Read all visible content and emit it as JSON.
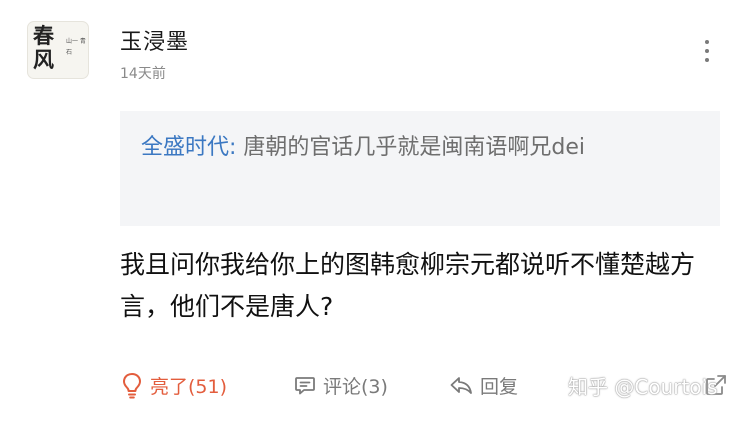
{
  "post": {
    "avatar_text": "春风",
    "avatar_small": "山一 青石",
    "author": "玉浸墨",
    "time": "14天前",
    "quote": {
      "name": "全盛时代:",
      "text": " 唐朝的官话几乎就是闽南语啊兄dei"
    },
    "content": "我且问你我给你上的图韩愈柳宗元都说听不懂楚越方言，他们不是唐人?",
    "actions": {
      "like_label": "亮了(51)",
      "comment_label": "评论(3)",
      "reply_label": "回复"
    },
    "watermark": "知乎 @Courtois"
  },
  "colors": {
    "accent_like": "#e35d3d",
    "quote_name": "#3b78c2",
    "quote_bg": "#f4f5f7"
  },
  "icons": [
    "more-vertical-icon",
    "lightbulb-icon",
    "comment-icon",
    "reply-icon",
    "share-icon"
  ]
}
